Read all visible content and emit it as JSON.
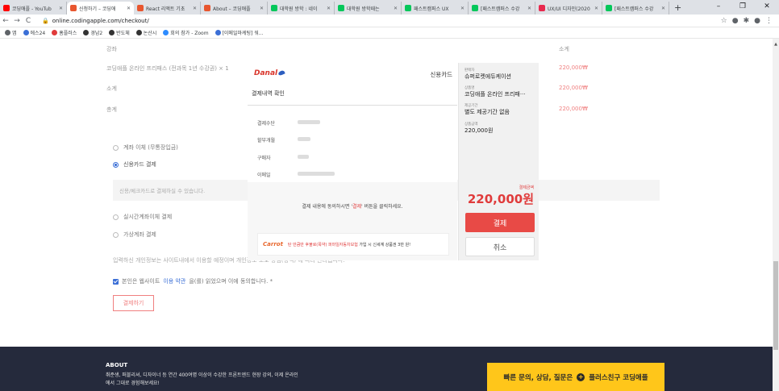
{
  "browser": {
    "tabs": [
      {
        "title": "코딩애플 - YouTub",
        "color": "#ff0000",
        "active": false
      },
      {
        "title": "신청하기 – 코딩애",
        "color": "#e8562f",
        "active": true
      },
      {
        "title": "React 리액트 기초",
        "color": "#e8562f",
        "active": false
      },
      {
        "title": "About – 코딩애플",
        "color": "#e8562f",
        "active": false
      },
      {
        "title": "대학원 방학 : 네이",
        "color": "#03c75a",
        "active": false
      },
      {
        "title": "대학원 방학때는 ",
        "color": "#03c75a",
        "active": false
      },
      {
        "title": "패스트캠퍼스 UX",
        "color": "#03c75a",
        "active": false
      },
      {
        "title": "[패스트캠퍼스 수강",
        "color": "#03c75a",
        "active": false
      },
      {
        "title": "UX/UI 디자인(2020",
        "color": "#e8294e",
        "active": false
      },
      {
        "title": "[패스트캠퍼스 수강",
        "color": "#03c75a",
        "active": false
      }
    ],
    "new_tab": "+",
    "window_controls": {
      "minimize": "–",
      "restore": "❐",
      "close": "✕"
    },
    "nav": {
      "back": "←",
      "forward": "→",
      "reload": "C"
    },
    "url": "online.codingapple.com/checkout/",
    "toolbar_icons": {
      "star": "☆",
      "ext1": "●",
      "ext2": "✱",
      "profile": "●",
      "menu": "⋮"
    },
    "bookmarks": [
      {
        "label": "앱",
        "color": "#5f6368"
      },
      {
        "label": "에스24",
        "color": "#3b6fd6"
      },
      {
        "label": "홈플러스",
        "color": "#e03b3b"
      },
      {
        "label": "경남2",
        "color": "#333"
      },
      {
        "label": "반도체",
        "color": "#333"
      },
      {
        "label": "논산시",
        "color": "#333"
      },
      {
        "label": "회의 참가 - Zoom",
        "color": "#2d8cff"
      },
      {
        "label": "[이메일마케팅] 워...",
        "color": "#3b6fd6"
      }
    ]
  },
  "checkout": {
    "header_left": "강좌",
    "header_right": "소계",
    "course_line": "코딩애플 온라인 프리패스 (전과목 1년 수강권) × 1",
    "course_price": "220,000₩",
    "subtotal_label": "소계",
    "subtotal_price": "220,000₩",
    "total_label": "총계",
    "total_price": "220,000₩",
    "payment_options": {
      "bank": "계좌 이체 (무통장입금)",
      "card": "신용카드 결제",
      "card_desc": "신용/체크카드로 결제하실 수 있습니다.",
      "realtime": "실시간계좌이체 결제",
      "virtual": "가상계좌 결제"
    },
    "privacy_notice": "입력하신 개인정보는 사이트내에서 이용할 예정이며 개인정보 보호 방침(정책) 에 따라 관리됩니다.",
    "agree_prefix": "본인은 웹사이트 ",
    "agree_link": "이용 약관",
    "agree_suffix": "을(를) 읽었으며 이에 동의합니다. *",
    "pay_button": "결제하기"
  },
  "danal": {
    "logo": "Danal",
    "method": "신용카드",
    "subtitle": "결제내역 확인",
    "fields": {
      "method_label": "결제수단",
      "installment_label": "할부개월",
      "buyer_label": "구매자",
      "email_label": "이메일"
    },
    "confirm_prefix": "결제 내용에 동의하시면 '",
    "confirm_highlight": "결제",
    "confirm_suffix": "' 버튼을 클릭하세요.",
    "ad_brand": "Carrot",
    "ad_text_red": "탄 만큼만 후불로(폭약) 퍼마일자동차보험",
    "ad_text": " 가입 시 신세계 상품권 3만 원!"
  },
  "side": {
    "seller_label": "판매자",
    "seller_value": "슈퍼로켓에듀케이션",
    "product_label": "상품명",
    "product_value": "코딩애플 온라인 프리패···",
    "period_label": "제공기간",
    "period_value": "별도 제공기간 없음",
    "amount_small_label": "상품금액",
    "amount_small_value": "220,000원",
    "total_label": "결제금액",
    "total_value": "220,000원",
    "pay": "결제",
    "cancel": "취소"
  },
  "footer": {
    "title": "ABOUT",
    "desc": "취준생, 퍼블리셔, 디자이너 등 연간 400여명 이상이 수강한 프론트엔드 현장 강의, 이제 온라인에서 그대로 경험해보세요!",
    "cta_text": "빠른 문의, 상담, 질문은",
    "cta_plus": "+",
    "cta_brand": "플러스친구 코딩애플"
  }
}
